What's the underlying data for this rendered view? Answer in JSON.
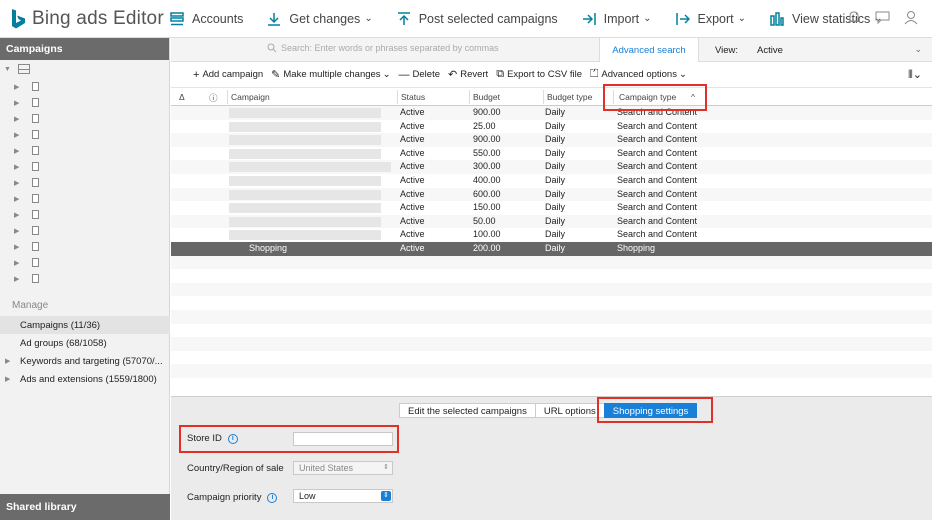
{
  "app": {
    "brand": "Bing ads Editor",
    "brand_accent_color": "#00809d"
  },
  "topbar": {
    "accounts": "Accounts",
    "get_changes": "Get changes",
    "post": "Post selected campaigns",
    "import": "Import",
    "export": "Export",
    "view_statistics": "View statistics"
  },
  "sidebar": {
    "header": "Campaigns",
    "manage_label": "Manage",
    "manage_items": [
      {
        "label": "Campaigns  (11/36)"
      },
      {
        "label": "Ad groups  (68/1058)"
      },
      {
        "label": "Keywords and targeting  (57070/..."
      },
      {
        "label": "Ads and extensions  (1559/1800)"
      }
    ],
    "shared_library": "Shared library"
  },
  "search": {
    "placeholder": "Search: Enter words or phrases separated by commas",
    "advanced": "Advanced search",
    "view_label": "View:",
    "view_value": "Active"
  },
  "toolbar": {
    "add": "Add campaign",
    "multiple": "Make multiple changes",
    "delete": "Delete",
    "revert": "Revert",
    "export_csv": "Export to CSV file",
    "advanced_options": "Advanced options"
  },
  "grid": {
    "columns": [
      "Campaign",
      "Status",
      "Budget",
      "Budget type",
      "Campaign type"
    ],
    "rows": [
      {
        "campaign": "",
        "status": "Active",
        "budget": "900.00",
        "budget_type": "Daily",
        "type": "Search and Content"
      },
      {
        "campaign": "",
        "status": "Active",
        "budget": "25.00",
        "budget_type": "Daily",
        "type": "Search and Content"
      },
      {
        "campaign": "",
        "status": "Active",
        "budget": "900.00",
        "budget_type": "Daily",
        "type": "Search and Content"
      },
      {
        "campaign": "",
        "status": "Active",
        "budget": "550.00",
        "budget_type": "Daily",
        "type": "Search and Content"
      },
      {
        "campaign": "",
        "status": "Active",
        "budget": "300.00",
        "budget_type": "Daily",
        "type": "Search and Content"
      },
      {
        "campaign": "",
        "status": "Active",
        "budget": "400.00",
        "budget_type": "Daily",
        "type": "Search and Content"
      },
      {
        "campaign": "",
        "status": "Active",
        "budget": "600.00",
        "budget_type": "Daily",
        "type": "Search and Content"
      },
      {
        "campaign": "",
        "status": "Active",
        "budget": "150.00",
        "budget_type": "Daily",
        "type": "Search and Content"
      },
      {
        "campaign": "",
        "status": "Active",
        "budget": "50.00",
        "budget_type": "Daily",
        "type": "Search and Content"
      },
      {
        "campaign": "",
        "status": "Active",
        "budget": "100.00",
        "budget_type": "Daily",
        "type": "Search and Content"
      },
      {
        "campaign": "Shopping",
        "status": "Active",
        "budget": "200.00",
        "budget_type": "Daily",
        "type": "Shopping"
      }
    ]
  },
  "edit_panel": {
    "tabs": [
      "Edit the selected campaigns",
      "URL options",
      "Shopping settings"
    ],
    "store_id_label": "Store ID",
    "store_id_value": "",
    "country_label": "Country/Region of sale",
    "country_value": "United States",
    "priority_label": "Campaign priority",
    "priority_value": "Low"
  }
}
